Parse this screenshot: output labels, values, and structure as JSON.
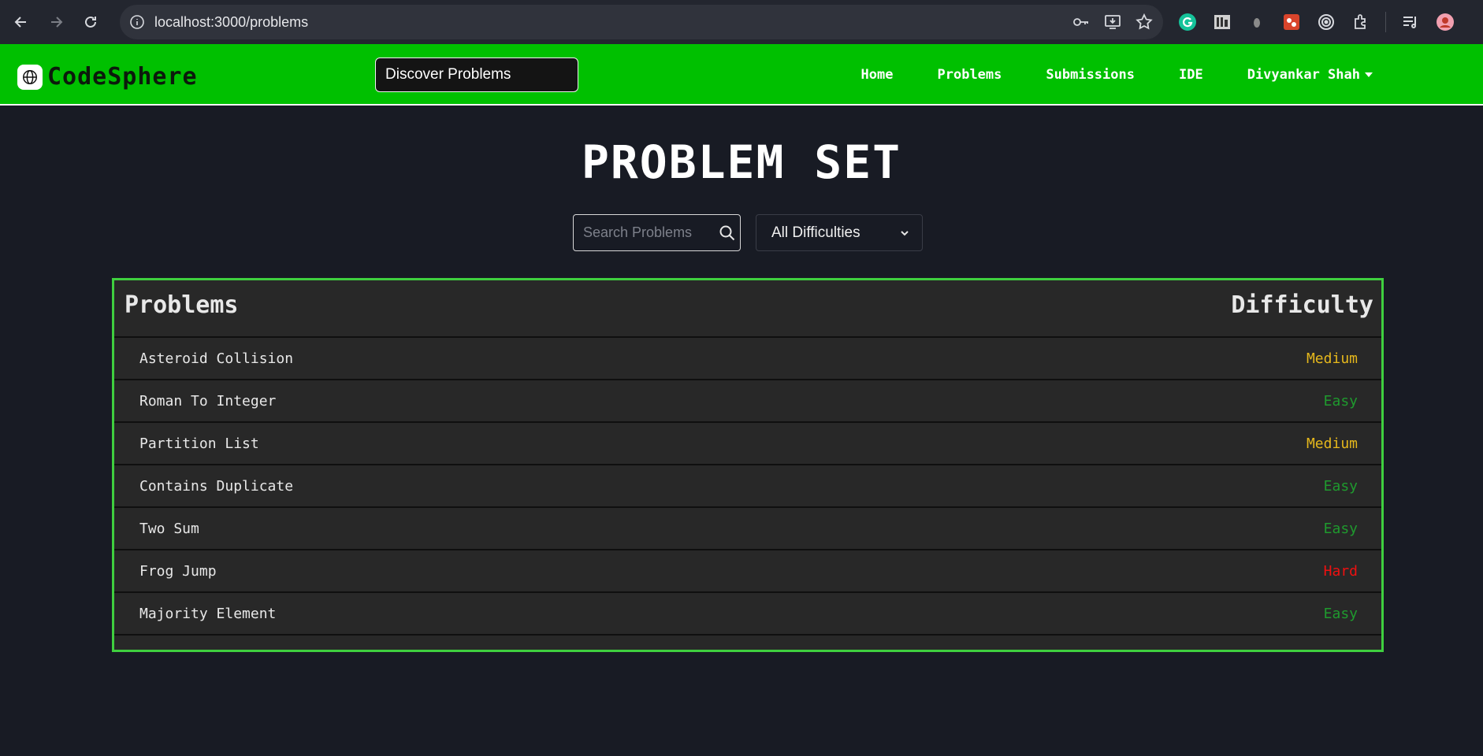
{
  "browser": {
    "url": "localhost:3000/problems",
    "extensions": [
      "grammarly-icon",
      "reader-icon",
      "mouse-icon",
      "puzzle-red-icon",
      "target-icon",
      "extensions-icon",
      "media-queue-icon",
      "profile-avatar"
    ]
  },
  "navbar": {
    "brand": "CodeSphere",
    "discover_label": "Discover Problems",
    "links": [
      "Home",
      "Problems",
      "Submissions",
      "IDE"
    ],
    "user": "Divyankar Shah"
  },
  "page": {
    "title": "PROBLEM SET",
    "search_placeholder": "Search Problems",
    "difficulty_filter": "All Difficulties"
  },
  "table": {
    "headers": {
      "problems": "Problems",
      "difficulty": "Difficulty"
    },
    "rows": [
      {
        "name": "Asteroid Collision",
        "difficulty": "Medium"
      },
      {
        "name": "Roman To Integer",
        "difficulty": "Easy"
      },
      {
        "name": "Partition List",
        "difficulty": "Medium"
      },
      {
        "name": "Contains Duplicate",
        "difficulty": "Easy"
      },
      {
        "name": "Two Sum",
        "difficulty": "Easy"
      },
      {
        "name": "Frog Jump",
        "difficulty": "Hard"
      },
      {
        "name": "Majority Element",
        "difficulty": "Easy"
      }
    ]
  },
  "colors": {
    "navbar_bg": "#00c000",
    "table_border": "#3fcf3f",
    "easy": "#1f9a2e",
    "medium": "#e6b81c",
    "hard": "#f01010"
  }
}
